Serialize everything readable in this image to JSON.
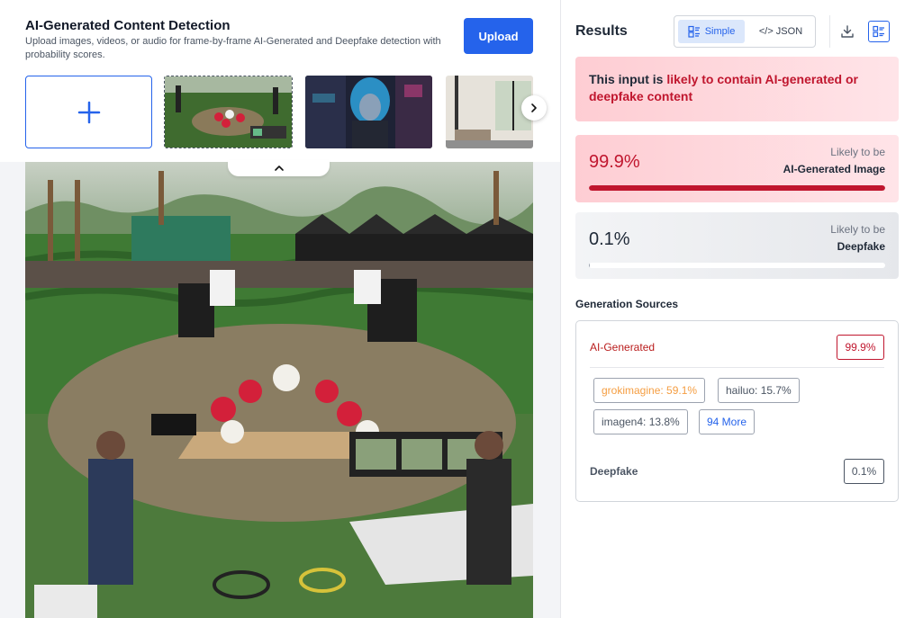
{
  "header": {
    "title": "AI-Generated Content Detection",
    "subtitle": "Upload images, videos, or audio for frame-by-frame AI-Generated and Deepfake detection with probability scores.",
    "upload_label": "Upload"
  },
  "icons": {
    "add": "plus-icon",
    "next": "chevron-right-icon",
    "collapse": "chevron-up-icon",
    "simple": "list-icon",
    "download": "download-icon",
    "layout": "layout-grid-icon"
  },
  "results": {
    "title": "Results",
    "view_simple": "Simple",
    "view_json": "</> JSON",
    "verdict_prefix": "This input is ",
    "verdict_highlight": "likely to contain AI-generated or deepfake content",
    "ai_score": "99.9%",
    "ai_score_fraction": 0.999,
    "ai_label_top": "Likely to be",
    "ai_label_bottom": "AI-Generated Image",
    "deepfake_score": "0.1%",
    "deepfake_score_fraction": 0.001,
    "deepfake_label_top": "Likely to be",
    "deepfake_label_bottom": "Deepfake"
  },
  "sources": {
    "title": "Generation Sources",
    "ai_label": "AI-Generated",
    "ai_value": "99.9%",
    "chips": [
      "grokimagine: 59.1%",
      "hailuo: 15.7%",
      "imagen4: 13.8%",
      "94 More"
    ],
    "deepfake_label": "Deepfake",
    "deepfake_value": "0.1%"
  },
  "colors": {
    "accent": "#2563eb",
    "alert": "#c0162e",
    "top_source": "#f59e42"
  }
}
